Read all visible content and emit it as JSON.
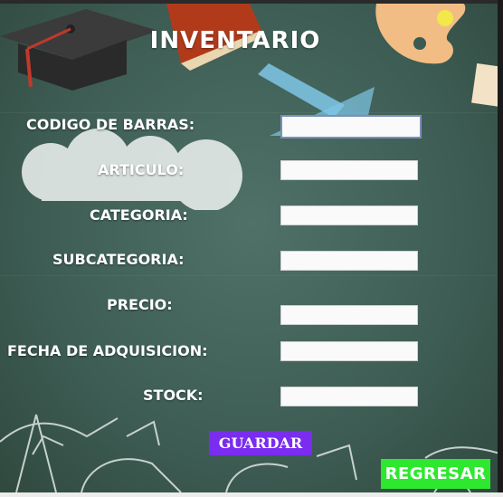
{
  "header": {
    "title": "INVENTARIO"
  },
  "form": {
    "fields": [
      {
        "label": "CODIGO DE BARRAS:",
        "value": ""
      },
      {
        "label": "ARTICULO:",
        "value": ""
      },
      {
        "label": "CATEGORIA:",
        "value": ""
      },
      {
        "label": "SUBCATEGORIA:",
        "value": ""
      },
      {
        "label": "PRECIO:",
        "value": ""
      },
      {
        "label": "FECHA DE ADQUISICION:",
        "value": ""
      },
      {
        "label": "STOCK:",
        "value": ""
      }
    ]
  },
  "actions": {
    "save_label": "GUARDAR",
    "back_label": "REGRESAR"
  },
  "colors": {
    "chalkboard": "#4f7167",
    "save_button": "#7a2cf0",
    "back_button": "#2ee82f"
  }
}
